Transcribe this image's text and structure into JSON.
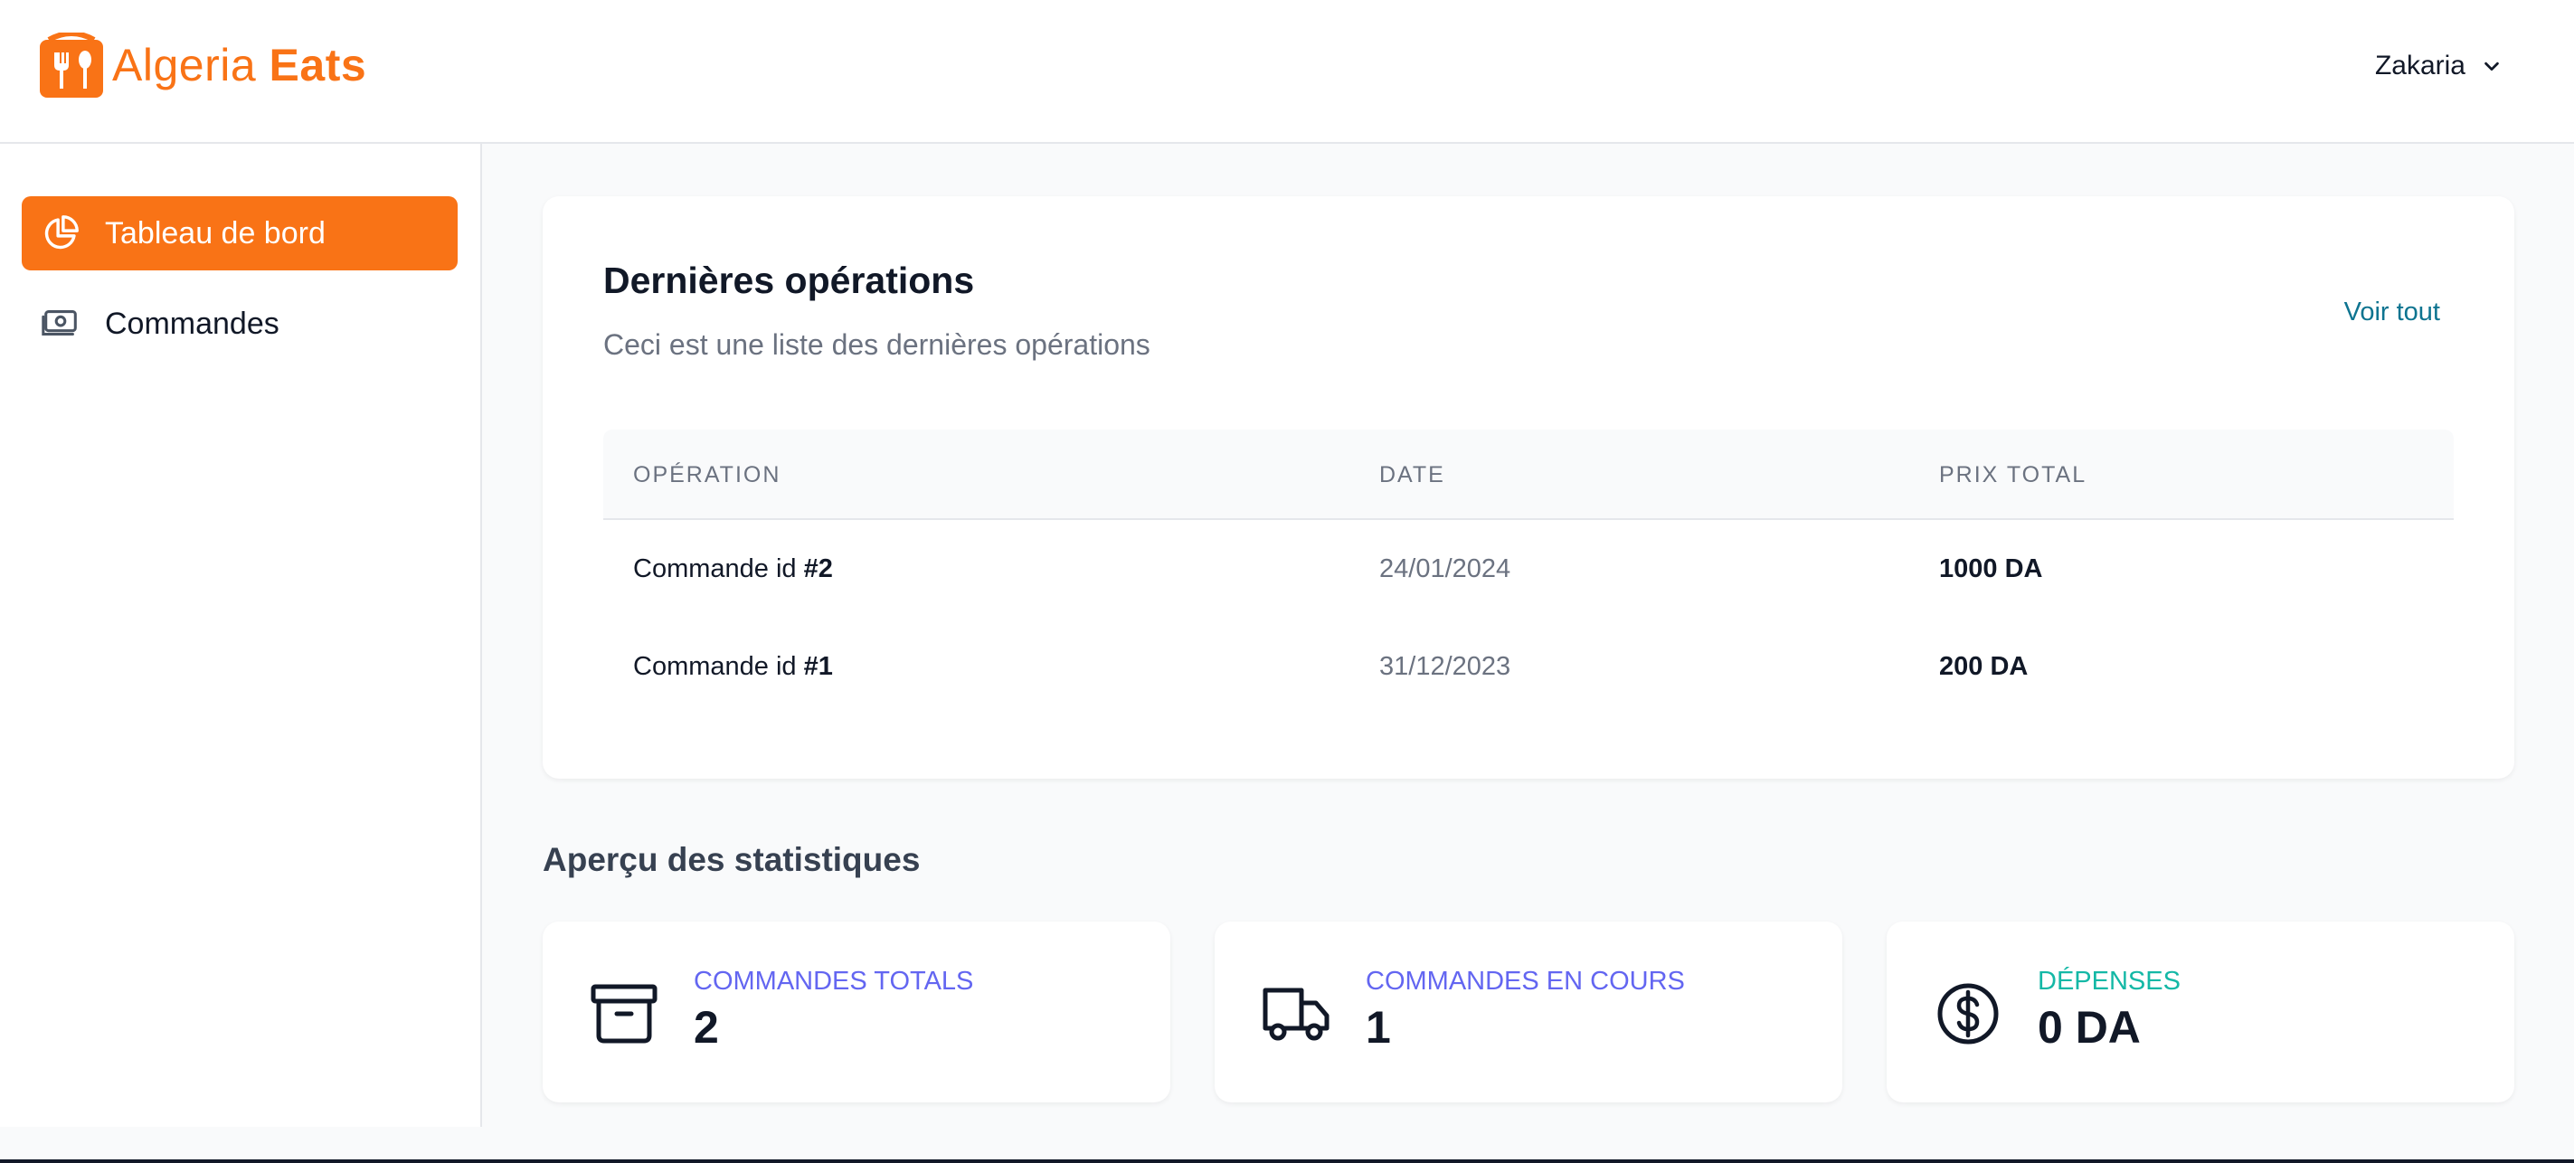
{
  "brand": {
    "name_part1": "Algeria",
    "name_part2": "Eats",
    "color": "#f97316"
  },
  "header": {
    "user_name": "Zakaria"
  },
  "sidebar": {
    "items": [
      {
        "label": "Tableau de bord",
        "icon": "pie-chart-icon",
        "active": true
      },
      {
        "label": "Commandes",
        "icon": "banknote-icon",
        "active": false
      }
    ]
  },
  "operations": {
    "title": "Dernières opérations",
    "subtitle": "Ceci est une liste des dernières opérations",
    "view_all": "Voir tout",
    "columns": [
      "Opération",
      "Date",
      "Prix total"
    ],
    "rows": [
      {
        "label": "Commande id",
        "id": "#2",
        "date": "24/01/2024",
        "price": "1000 DA"
      },
      {
        "label": "Commande id",
        "id": "#1",
        "date": "31/12/2023",
        "price": "200 DA"
      }
    ]
  },
  "stats": {
    "title": "Aperçu des statistiques",
    "cards": [
      {
        "label": "Commandes totals",
        "value": "2",
        "icon": "archive-box-icon",
        "color": "#6366f1"
      },
      {
        "label": "Commandes en cours",
        "value": "1",
        "icon": "truck-icon",
        "color": "#6366f1"
      },
      {
        "label": "Dépenses",
        "value": "0 DA",
        "icon": "dollar-circle-icon",
        "color": "#14b8a6"
      }
    ]
  }
}
